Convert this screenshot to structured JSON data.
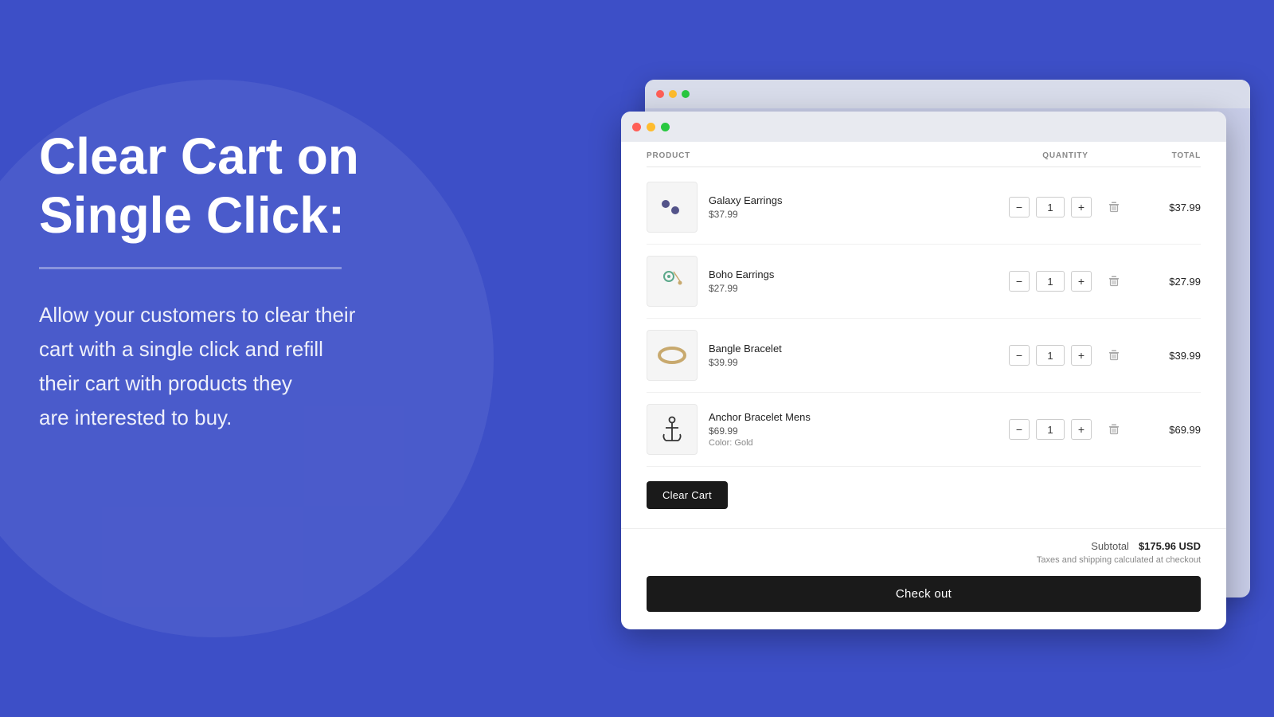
{
  "background": {
    "color": "#3d4fc7"
  },
  "left": {
    "headline": "Clear Cart on\nSingle Click:",
    "headline_line1": "Clear Cart on",
    "headline_line2": "Single Click:",
    "description": "Allow your customers to clear their\ncart with a single click and refill\ntheir cart with products they\nare interested to buy."
  },
  "browser": {
    "back_dots": [
      "#ff5f57",
      "#febc2e",
      "#28c840"
    ],
    "front_dots": [
      "#ff5f57",
      "#febc2e",
      "#28c840"
    ],
    "columns": {
      "product": "PRODUCT",
      "quantity": "QUANTITY",
      "total": "TOTAL"
    },
    "items": [
      {
        "id": "1",
        "name": "Galaxy Earrings",
        "price": "$37.99",
        "variant": null,
        "quantity": 1,
        "total": "$37.99",
        "thumb_type": "earring1"
      },
      {
        "id": "2",
        "name": "Boho Earrings",
        "price": "$27.99",
        "variant": null,
        "quantity": 1,
        "total": "$27.99",
        "thumb_type": "earring2"
      },
      {
        "id": "3",
        "name": "Bangle Bracelet",
        "price": "$39.99",
        "variant": null,
        "quantity": 1,
        "total": "$39.99",
        "thumb_type": "bangle"
      },
      {
        "id": "4",
        "name": "Anchor Bracelet Mens",
        "price": "$69.99",
        "variant": "Color: Gold",
        "quantity": 1,
        "total": "$69.99",
        "thumb_type": "anchor"
      }
    ],
    "clear_cart_label": "Clear Cart",
    "subtotal_label": "Subtotal",
    "subtotal_value": "$175.96 USD",
    "tax_note": "Taxes and shipping calculated at checkout",
    "checkout_label": "Check out"
  }
}
